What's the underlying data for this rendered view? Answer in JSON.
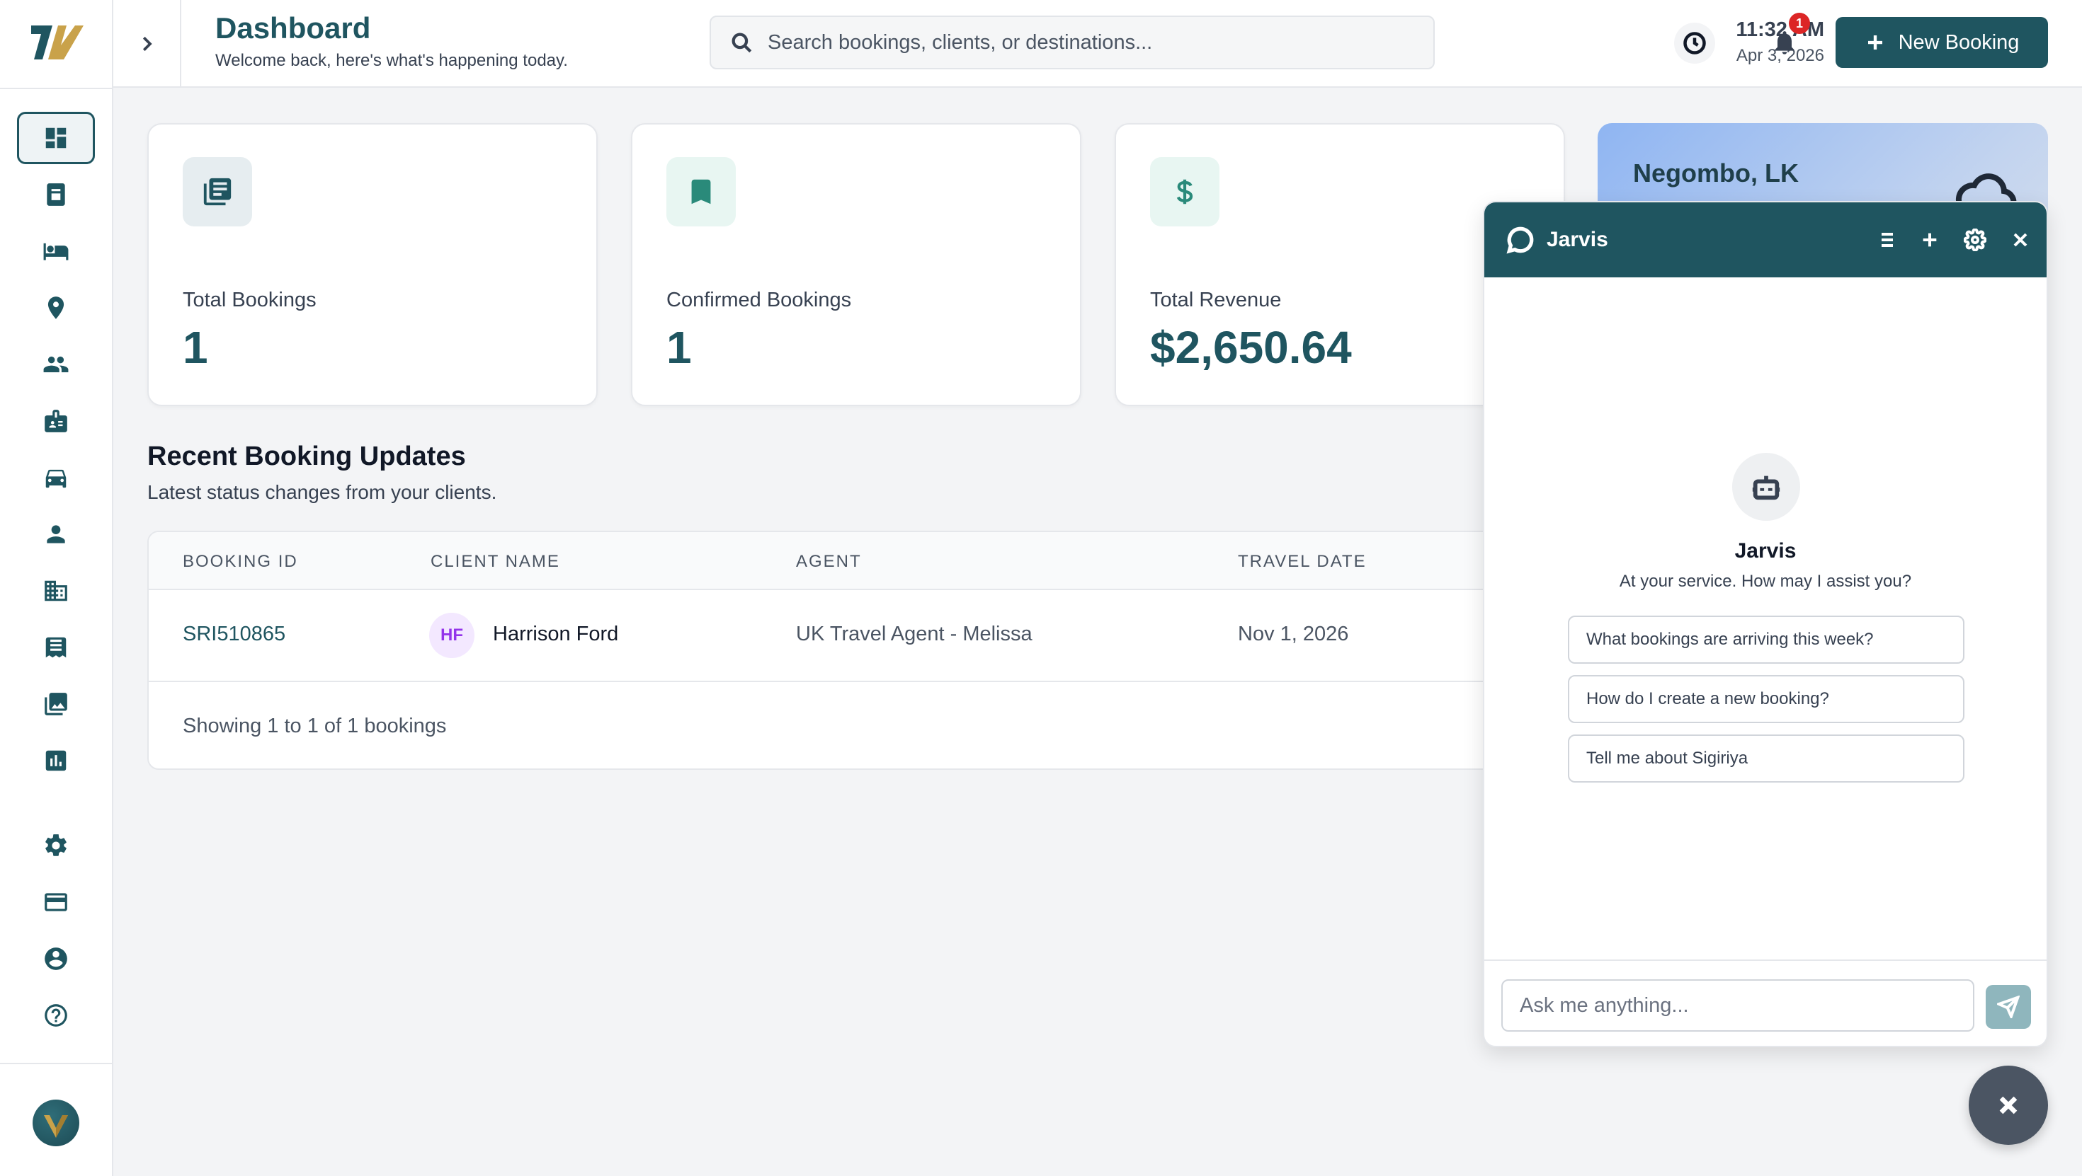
{
  "header": {
    "title": "Dashboard",
    "subtitle": "Welcome back, here's what's happening today.",
    "search_placeholder": "Search bookings, clients, or destinations...",
    "time": "11:32 AM",
    "date": "Apr 3, 2026",
    "notification_count": "1",
    "new_booking_label": "New Booking"
  },
  "sidebar": {
    "items": [
      {
        "icon": "dashboard-icon",
        "active": true
      },
      {
        "icon": "document-icon"
      },
      {
        "icon": "bed-icon"
      },
      {
        "icon": "location-pin-icon"
      },
      {
        "icon": "people-icon"
      },
      {
        "icon": "badge-icon"
      },
      {
        "icon": "car-icon"
      },
      {
        "icon": "person-icon"
      },
      {
        "icon": "building-icon"
      },
      {
        "icon": "receipt-icon"
      },
      {
        "icon": "photo-library-icon"
      },
      {
        "icon": "bar-chart-icon"
      },
      {
        "icon": "gear-icon"
      },
      {
        "icon": "credit-card-icon"
      },
      {
        "icon": "account-circle-icon"
      },
      {
        "icon": "help-icon"
      }
    ]
  },
  "stats": [
    {
      "label": "Total Bookings",
      "value": "1",
      "icon": "list-icon",
      "icon_bg": "#e6edf0",
      "icon_color": "#1f5560"
    },
    {
      "label": "Confirmed Bookings",
      "value": "1",
      "icon": "bookmark-icon",
      "icon_bg": "#e8f6f2",
      "icon_color": "#2a8a7a"
    },
    {
      "label": "Total Revenue",
      "value": "$2,650.64",
      "icon": "dollar-icon",
      "icon_bg": "#e8f6f2",
      "icon_color": "#2a8a7a"
    }
  ],
  "weather": {
    "city": "Negombo, LK",
    "icon": "cloud-icon"
  },
  "recent": {
    "title": "Recent Booking Updates",
    "subtitle": "Latest status changes from your clients.",
    "columns": [
      "BOOKING ID",
      "CLIENT NAME",
      "AGENT",
      "TRAVEL DATE"
    ],
    "rows": [
      {
        "booking_id": "SRI510865",
        "initials": "HF",
        "client": "Harrison Ford",
        "agent": "UK Travel Agent - Melissa",
        "travel_date": "Nov 1, 2026"
      }
    ],
    "footer": "Showing 1 to 1 of 1 bookings"
  },
  "chat": {
    "title": "Jarvis",
    "bot_name": "Jarvis",
    "tagline": "At your service. How may I assist you?",
    "suggestions": [
      "What bookings are arriving this week?",
      "How do I create a new booking?",
      "Tell me about Sigiriya"
    ],
    "input_placeholder": "Ask me anything..."
  },
  "colors": {
    "brand": "#1f5560",
    "accent_teal": "#2a8a7a",
    "badge_red": "#dc2626"
  }
}
